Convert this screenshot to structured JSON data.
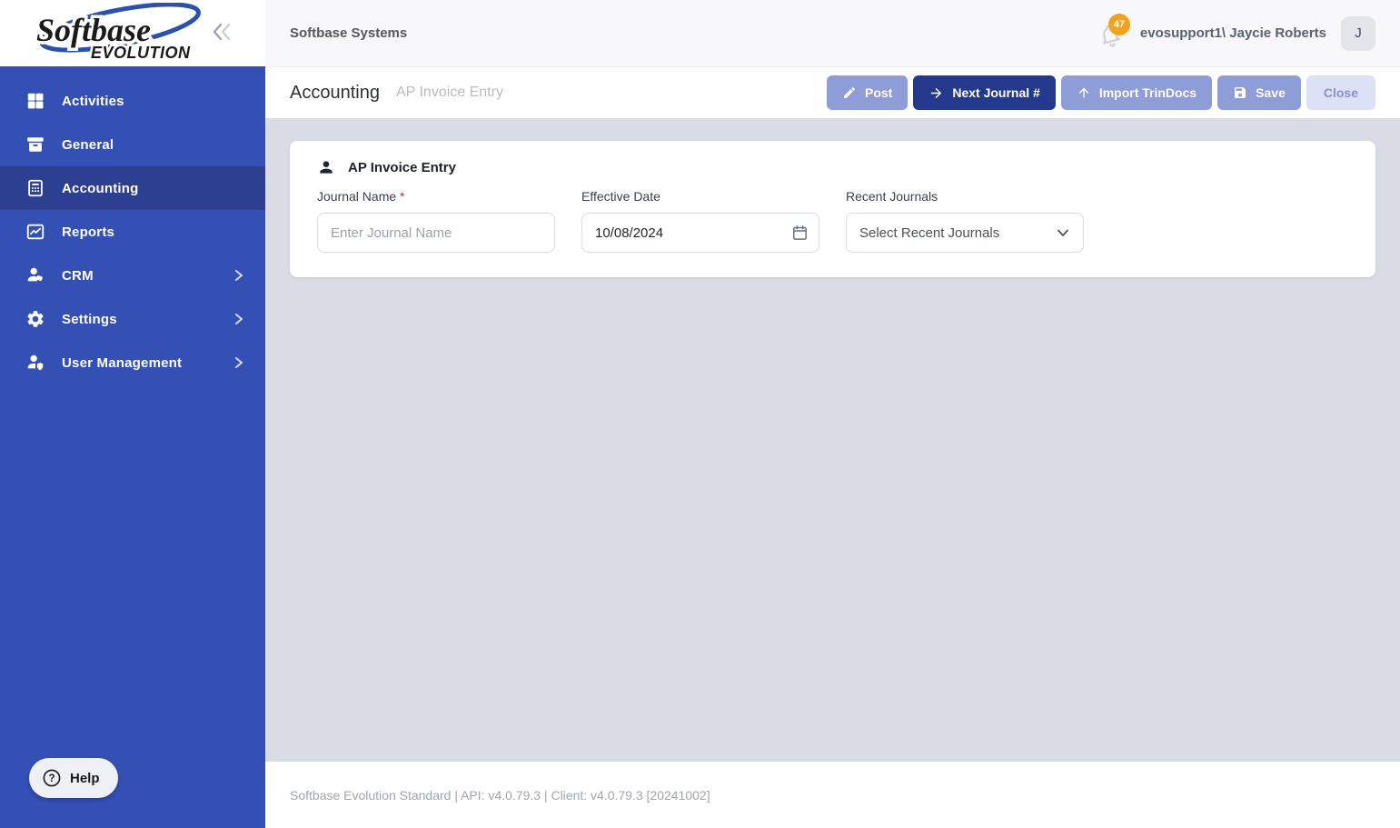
{
  "colors": {
    "sidebar_bg": "#3450b4",
    "sidebar_selected_bg": "#2c3f90",
    "topbar_bg": "#f8f8fa",
    "content_bg": "#d9dbe5",
    "button_primary": "#24388c",
    "button_muted": "#8e9dd8",
    "button_close_bg": "#dce1f5",
    "badge_orange": "#f2a31b",
    "required_red": "#e03131"
  },
  "sidebar": {
    "logo": {
      "brand": "Softbase",
      "sub": "EVOLUTION"
    },
    "items": [
      {
        "label": "Activities",
        "icon": "grid-icon",
        "selected": false,
        "has_chevron": false
      },
      {
        "label": "General",
        "icon": "archive-icon",
        "selected": false,
        "has_chevron": false
      },
      {
        "label": "Accounting",
        "icon": "calculator-icon",
        "selected": true,
        "has_chevron": false
      },
      {
        "label": "Reports",
        "icon": "chart-icon",
        "selected": false,
        "has_chevron": false
      },
      {
        "label": "CRM",
        "icon": "person-tag-icon",
        "selected": false,
        "has_chevron": true
      },
      {
        "label": "Settings",
        "icon": "gear-icon",
        "selected": false,
        "has_chevron": true
      },
      {
        "label": "User Management",
        "icon": "person-shield-icon",
        "selected": false,
        "has_chevron": true
      }
    ],
    "help_label": "Help"
  },
  "topbar": {
    "title": "Softbase Systems",
    "notification_count": "47",
    "user_name": "evosupport1\\ Jaycie Roberts",
    "avatar_initial": "J"
  },
  "page_header": {
    "title": "Accounting",
    "subtitle": "AP Invoice Entry",
    "buttons": [
      "Post",
      "Next Journal #",
      "Import TrinDocs",
      "Save",
      "Close"
    ]
  },
  "form": {
    "card_title": "AP Invoice Entry",
    "journal_name": {
      "label": "Journal Name",
      "required_mark": "*",
      "placeholder": "Enter Journal Name",
      "value": ""
    },
    "effective_date": {
      "label": "Effective Date",
      "value": "10/08/2024"
    },
    "recent_journals": {
      "label": "Recent Journals",
      "value": "Select Recent Journals"
    }
  },
  "footer": {
    "text": "Softbase Evolution Standard | API: v4.0.79.3 | Client: v4.0.79.3 [20241002]"
  }
}
